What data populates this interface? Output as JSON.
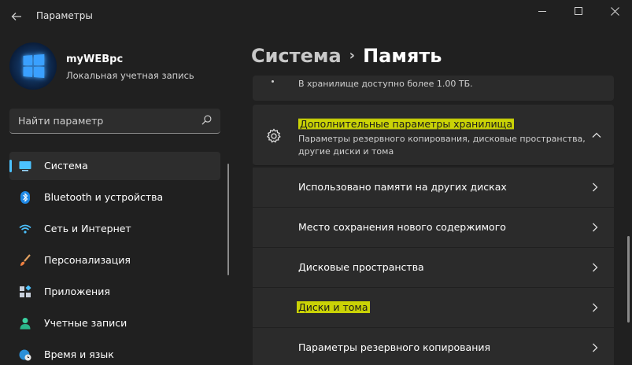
{
  "window": {
    "title": "Параметры",
    "back_icon": "back-arrow-icon"
  },
  "profile": {
    "name": "myWEBpc",
    "account_type": "Локальная учетная запись"
  },
  "search": {
    "placeholder": "Найти параметр",
    "icon": "search-icon"
  },
  "nav": {
    "items": [
      {
        "label": "Система",
        "icon": "monitor-icon",
        "selected": true
      },
      {
        "label": "Bluetooth и устройства",
        "icon": "bluetooth-icon"
      },
      {
        "label": "Сеть и Интернет",
        "icon": "wifi-icon"
      },
      {
        "label": "Персонализация",
        "icon": "brush-icon"
      },
      {
        "label": "Приложения",
        "icon": "apps-icon"
      },
      {
        "label": "Учетные записи",
        "icon": "person-icon"
      },
      {
        "label": "Время и язык",
        "icon": "globe-clock-icon"
      }
    ]
  },
  "breadcrumb": {
    "parent": "Система",
    "separator": "›",
    "current": "Память"
  },
  "content": {
    "top_card_text": "В хранилище доступно более 1.00 ТБ.",
    "expander": {
      "title": "Дополнительные параметры хранилища",
      "description": "Параметры резервного копирования, дисковые пространства, другие диски и тома",
      "icon": "gear-icon",
      "expanded": true
    },
    "sub_items": [
      {
        "label": "Использовано памяти на других дисках"
      },
      {
        "label": "Место сохранения нового содержимого"
      },
      {
        "label": "Дисковые пространства"
      },
      {
        "label": "Диски и тома",
        "highlighted": true
      },
      {
        "label": "Параметры резервного копирования"
      }
    ]
  },
  "colors": {
    "background": "#202020",
    "card": "#2b2b2b",
    "accent": "#4cc2ff",
    "highlight": "#e6f000"
  }
}
